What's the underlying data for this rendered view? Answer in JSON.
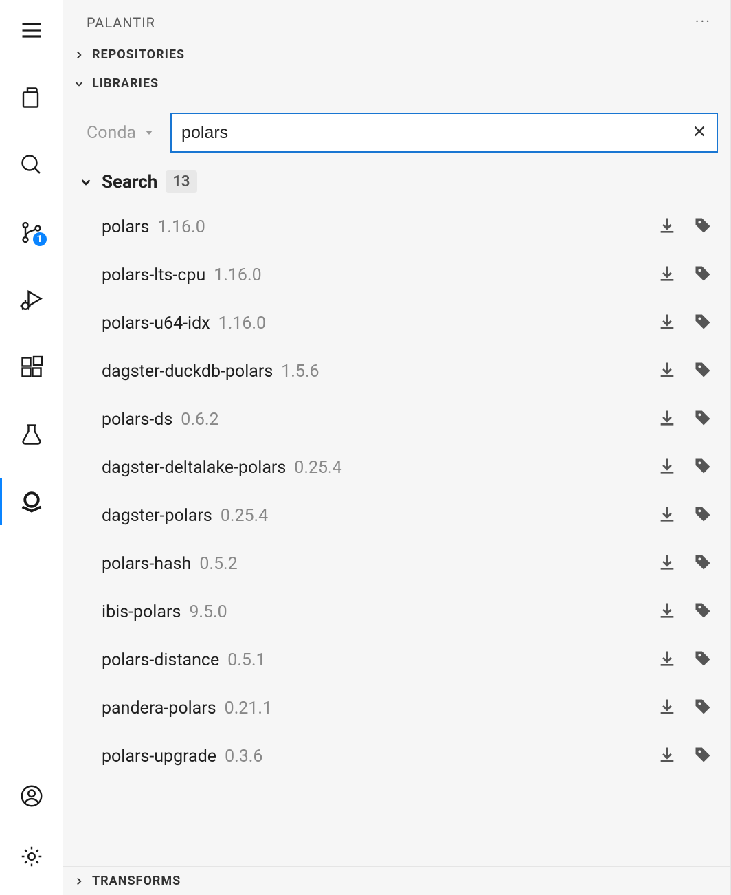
{
  "panel": {
    "title": "PALANTIR"
  },
  "sections": {
    "repositories": "REPOSITORIES",
    "libraries": "LIBRARIES",
    "transforms": "TRANSFORMS"
  },
  "source_selector": {
    "label": "Conda"
  },
  "search": {
    "value": "polars",
    "results_label": "Search",
    "count": "13"
  },
  "activity": {
    "scm_badge": "1"
  },
  "packages": [
    {
      "name": "polars",
      "version": "1.16.0"
    },
    {
      "name": "polars-lts-cpu",
      "version": "1.16.0"
    },
    {
      "name": "polars-u64-idx",
      "version": "1.16.0"
    },
    {
      "name": "dagster-duckdb-polars",
      "version": "1.5.6"
    },
    {
      "name": "polars-ds",
      "version": "0.6.2"
    },
    {
      "name": "dagster-deltalake-polars",
      "version": "0.25.4"
    },
    {
      "name": "dagster-polars",
      "version": "0.25.4"
    },
    {
      "name": "polars-hash",
      "version": "0.5.2"
    },
    {
      "name": "ibis-polars",
      "version": "9.5.0"
    },
    {
      "name": "polars-distance",
      "version": "0.5.1"
    },
    {
      "name": "pandera-polars",
      "version": "0.21.1"
    },
    {
      "name": "polars-upgrade",
      "version": "0.3.6"
    }
  ]
}
